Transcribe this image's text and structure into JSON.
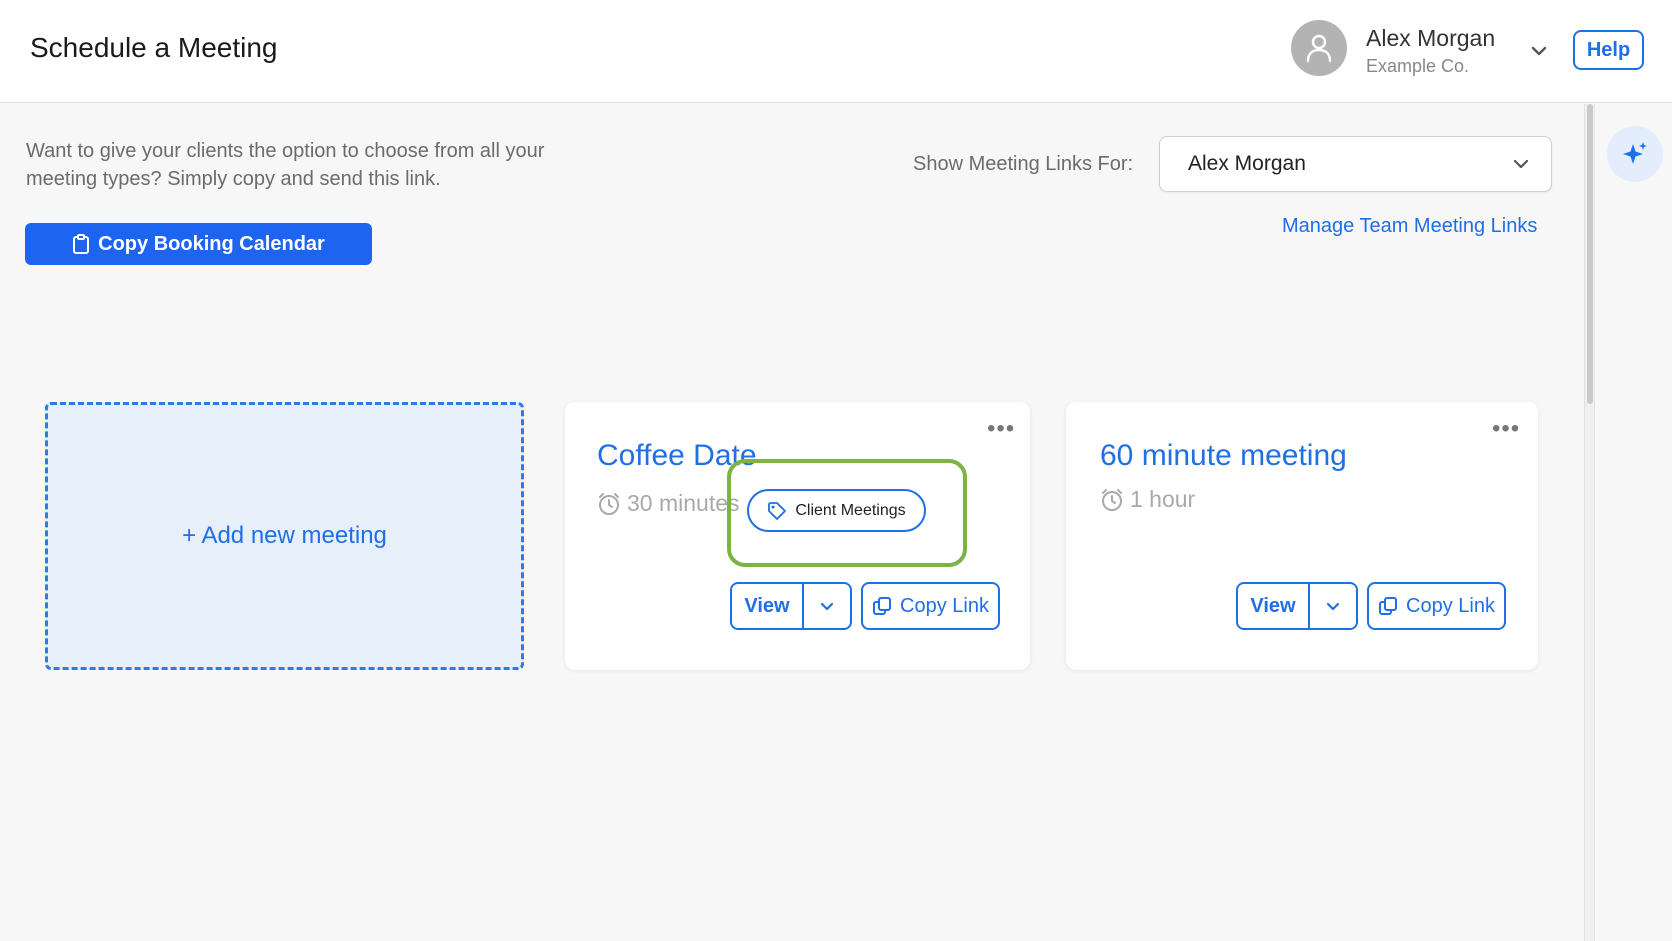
{
  "header": {
    "title": "Schedule a Meeting",
    "user_name": "Alex Morgan",
    "user_company": "Example Co.",
    "help_label": "Help"
  },
  "intro": {
    "text": "Want to give your clients the option to choose from all your meeting types? Simply copy and send this link.",
    "copy_calendar_label": "Copy Booking Calendar"
  },
  "filter": {
    "label": "Show Meeting Links For:",
    "selected": "Alex Morgan",
    "manage_link": "Manage Team Meeting Links"
  },
  "add_card": {
    "label": "+ Add new meeting"
  },
  "meetings": [
    {
      "title": "Coffee Date",
      "duration": "30 minutes",
      "tag": "Client Meetings",
      "view_label": "View",
      "copy_label": "Copy Link",
      "menu_label": "•••"
    },
    {
      "title": "60 minute meeting",
      "duration": "1 hour",
      "view_label": "View",
      "copy_label": "Copy Link",
      "menu_label": "•••"
    }
  ],
  "colors": {
    "accent": "#1f6fe5",
    "primary_button": "#1d64f0",
    "highlight": "#7cb342",
    "add_card_bg": "#e7f0fa"
  },
  "icons": [
    "user-icon",
    "chevron-down-icon",
    "clipboard-icon",
    "clock-icon",
    "tag-icon",
    "copy-icon",
    "sparkle-icon",
    "more-icon"
  ]
}
